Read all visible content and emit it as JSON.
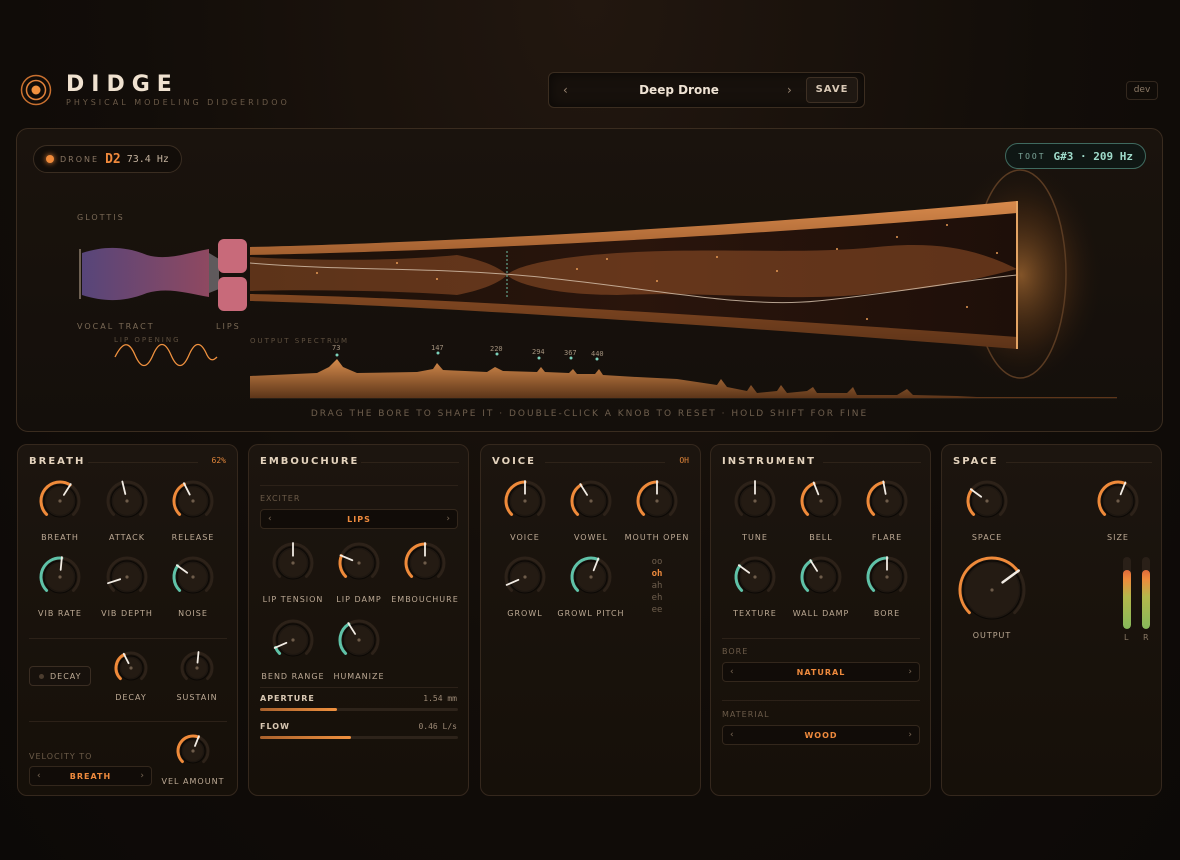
{
  "header": {
    "title": "DIDGE",
    "subtitle": "PHYSICAL MODELING DIDGERIDOO",
    "preset_name": "Deep Drone",
    "prev": "‹",
    "next": "›",
    "save_label": "SAVE",
    "dev_label": "dev"
  },
  "visual": {
    "drone_label": "DRONE",
    "drone_note": "D2",
    "drone_hz": "73.4 Hz",
    "toot_label": "TOOT",
    "toot_value": "G#3 · 209 Hz",
    "glottis_label": "GLOTTIS",
    "vocal_tract_label": "VOCAL TRACT",
    "lips_label": "LIPS",
    "lip_opening_label": "LIP OPENING",
    "spectrum_label": "OUTPUT SPECTRUM",
    "peaks": [
      {
        "label": "73"
      },
      {
        "label": "147"
      },
      {
        "label": "220"
      },
      {
        "label": "294"
      },
      {
        "label": "367"
      },
      {
        "label": "440"
      }
    ],
    "hint": "DRAG THE BORE TO SHAPE IT · DOUBLE-CLICK A KNOB TO RESET · HOLD SHIFT FOR FINE"
  },
  "colors": {
    "accent": "#ef8a3a",
    "teal": "#5fc2a8",
    "white_indicator": "#f2ece4"
  },
  "breath": {
    "title": "BREATH",
    "value": "62%",
    "knobs": [
      {
        "label": "BREATH",
        "value": 0.62,
        "color": "orange"
      },
      {
        "label": "ATTACK",
        "value": 0.45,
        "color": "white"
      },
      {
        "label": "RELEASE",
        "value": 0.4,
        "color": "orange"
      },
      {
        "label": "VIB RATE",
        "value": 0.52,
        "color": "teal"
      },
      {
        "label": "VIB DEPTH",
        "value": 0.1,
        "color": "white"
      },
      {
        "label": "NOISE",
        "value": 0.3,
        "color": "teal"
      }
    ],
    "decay_button": "DECAY",
    "decay_knob": {
      "label": "DECAY",
      "value": 0.4,
      "color": "orange"
    },
    "sustain_knob": {
      "label": "SUSTAIN",
      "value": 0.52,
      "color": "white"
    },
    "velocity_to_label": "VELOCITY TO",
    "velocity_target": "BREATH",
    "vel_amount_knob": {
      "label": "VEL AMOUNT",
      "value": 0.58,
      "color": "orange"
    }
  },
  "embouchure": {
    "title": "EMBOUCHURE",
    "exciter_label": "EXCITER",
    "exciter_value": "LIPS",
    "knobs": [
      {
        "label": "LIP TENSION",
        "value": 0.5,
        "color": "white"
      },
      {
        "label": "LIP DAMP",
        "value": 0.25,
        "color": "orange"
      },
      {
        "label": "EMBOUCHURE",
        "value": 0.5,
        "color": "orange"
      },
      {
        "label": "BEND RANGE",
        "value": 0.08,
        "color": "teal"
      },
      {
        "label": "HUMANIZE",
        "value": 0.38,
        "color": "teal"
      }
    ],
    "aperture_label": "APERTURE",
    "aperture_value": "1.54 mm",
    "aperture_fraction": 0.39,
    "flow_label": "FLOW",
    "flow_value": "0.46 L/s",
    "flow_fraction": 0.46
  },
  "voice": {
    "title": "VOICE",
    "value": "OH",
    "knobs": [
      {
        "label": "VOICE",
        "value": 0.5,
        "color": "orange"
      },
      {
        "label": "VOWEL",
        "value": 0.38,
        "color": "orange"
      },
      {
        "label": "MOUTH OPEN",
        "value": 0.5,
        "color": "orange"
      },
      {
        "label": "GROWL",
        "value": 0.08,
        "color": "white"
      },
      {
        "label": "GROWL PITCH",
        "value": 0.58,
        "color": "teal"
      }
    ],
    "vowels": [
      "oo",
      "oh",
      "ah",
      "eh",
      "ee"
    ],
    "selected_vowel": "oh"
  },
  "instrument": {
    "title": "INSTRUMENT",
    "knobs": [
      {
        "label": "TUNE",
        "value": 0.5,
        "color": "white"
      },
      {
        "label": "BELL",
        "value": 0.42,
        "color": "orange"
      },
      {
        "label": "FLARE",
        "value": 0.46,
        "color": "orange"
      },
      {
        "label": "TEXTURE",
        "value": 0.3,
        "color": "teal"
      },
      {
        "label": "WALL DAMP",
        "value": 0.38,
        "color": "teal"
      },
      {
        "label": "BORE",
        "value": 0.5,
        "color": "teal"
      }
    ],
    "bore_label": "BORE",
    "bore_value": "NATURAL",
    "material_label": "MATERIAL",
    "material_value": "WOOD"
  },
  "space": {
    "title": "SPACE",
    "knobs": [
      {
        "label": "SPACE",
        "value": 0.3,
        "color": "orange"
      },
      {
        "label": "SIZE",
        "value": 0.58,
        "color": "orange"
      }
    ],
    "output_knob": {
      "label": "OUTPUT",
      "value": 0.7,
      "color": "orange"
    },
    "meter_l_label": "L",
    "meter_r_label": "R",
    "meter_l": 0.82,
    "meter_r": 0.82
  }
}
